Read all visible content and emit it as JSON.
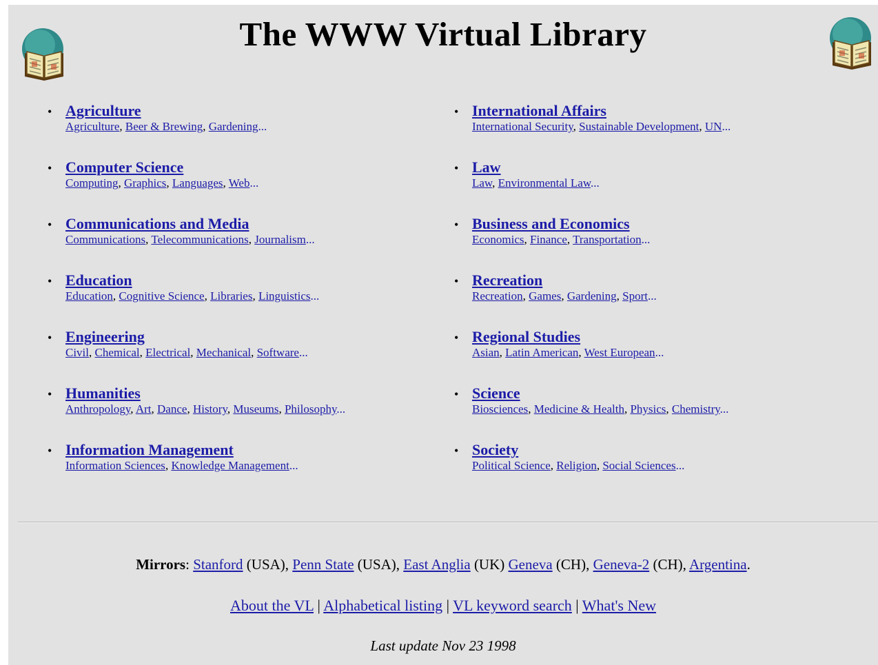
{
  "header": {
    "title": "The WWW Virtual Library",
    "logo_icon": "book-globe-icon"
  },
  "categories_left": [
    {
      "title": "Agriculture",
      "subs": [
        "Agriculture",
        "Beer & Brewing",
        "Gardening"
      ]
    },
    {
      "title": "Computer Science",
      "subs": [
        "Computing",
        "Graphics",
        "Languages",
        "Web"
      ]
    },
    {
      "title": "Communications and Media",
      "subs": [
        "Communications",
        "Telecommunications",
        "Journalism"
      ]
    },
    {
      "title": "Education",
      "subs": [
        "Education",
        "Cognitive Science",
        "Libraries",
        "Linguistics"
      ]
    },
    {
      "title": "Engineering",
      "subs": [
        "Civil",
        "Chemical",
        "Electrical",
        "Mechanical",
        "Software"
      ]
    },
    {
      "title": "Humanities",
      "subs": [
        "Anthropology",
        "Art",
        "Dance",
        "History",
        "Museums",
        "Philosophy"
      ]
    },
    {
      "title": "Information Management",
      "subs": [
        "Information Sciences",
        "Knowledge Management"
      ]
    }
  ],
  "categories_right": [
    {
      "title": "International Affairs",
      "subs": [
        "International Security",
        "Sustainable Development",
        "UN"
      ]
    },
    {
      "title": "Law",
      "subs": [
        "Law",
        "Environmental Law"
      ]
    },
    {
      "title": "Business and Economics",
      "subs": [
        "Economics",
        "Finance",
        "Transportation"
      ]
    },
    {
      "title": "Recreation",
      "subs": [
        "Recreation",
        "Games",
        "Gardening",
        "Sport"
      ]
    },
    {
      "title": "Regional Studies",
      "subs": [
        "Asian",
        "Latin American",
        "West European"
      ]
    },
    {
      "title": "Science",
      "subs": [
        "Biosciences",
        "Medicine & Health",
        "Physics",
        "Chemistry"
      ]
    },
    {
      "title": "Society",
      "subs": [
        "Political Science",
        "Religion",
        "Social Sciences"
      ]
    }
  ],
  "mirrors": {
    "label": "Mirrors",
    "items": [
      {
        "name": "Stanford",
        "country": "(USA)"
      },
      {
        "name": "Penn State",
        "country": "(USA)"
      },
      {
        "name": "East Anglia",
        "country": "(UK)"
      },
      {
        "name": "Geneva",
        "country": "(CH)"
      },
      {
        "name": "Geneva-2",
        "country": "(CH)"
      },
      {
        "name": "Argentina",
        "country": ""
      }
    ]
  },
  "footer_links": [
    "About the VL",
    "Alphabetical listing",
    "VL keyword search",
    "What's New"
  ],
  "last_update": "Last update Nov 23 1998",
  "colors": {
    "background": "#e2e2e2",
    "link": "#1c1ca8"
  }
}
